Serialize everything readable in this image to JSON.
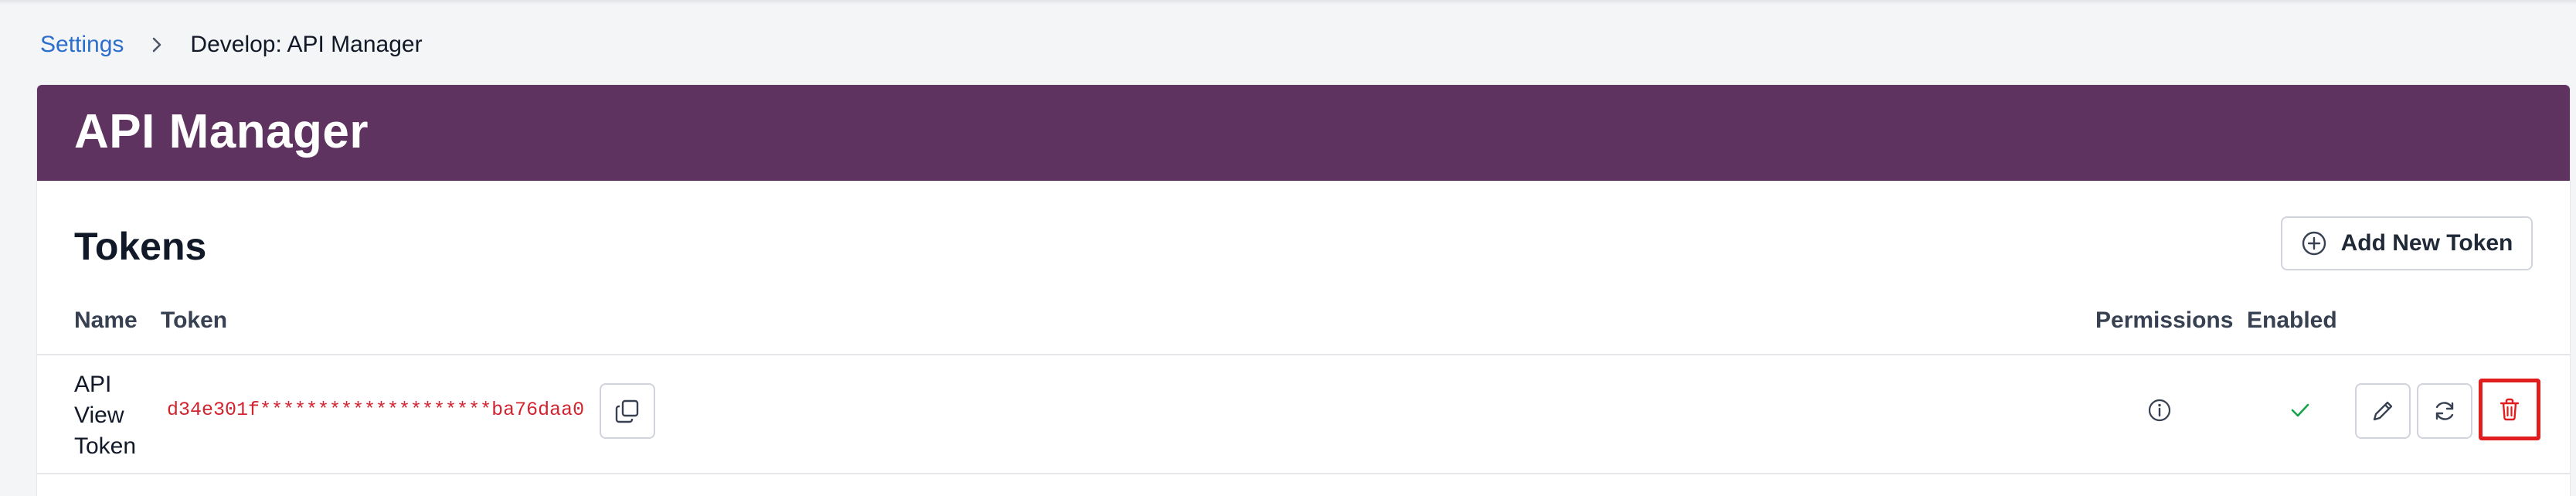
{
  "breadcrumb": {
    "link": "Settings",
    "current": "Develop: API Manager"
  },
  "header": {
    "title": "API Manager",
    "bg_color": "#5f3360"
  },
  "tokens": {
    "title": "Tokens",
    "add_button": "Add New Token",
    "columns": {
      "name": "Name",
      "token": "Token",
      "permissions": "Permissions",
      "enabled": "Enabled"
    },
    "rows": [
      {
        "name_lines": [
          "API",
          "View",
          "Token"
        ],
        "token": "d34e301f********************ba76daa0",
        "enabled": true
      }
    ]
  },
  "icons": {
    "breadcrumb_sep": "chevron-right-icon",
    "add": "plus-circle-icon",
    "copy": "copy-icon",
    "permissions": "info-icon",
    "enabled": "check-icon",
    "edit": "pencil-icon",
    "refresh": "refresh-icon",
    "delete": "trash-icon"
  },
  "colors": {
    "link": "#2c6ecb",
    "token_text": "#d1242f",
    "enabled_check": "#16a34a",
    "delete_highlight": "#e11d1d"
  }
}
